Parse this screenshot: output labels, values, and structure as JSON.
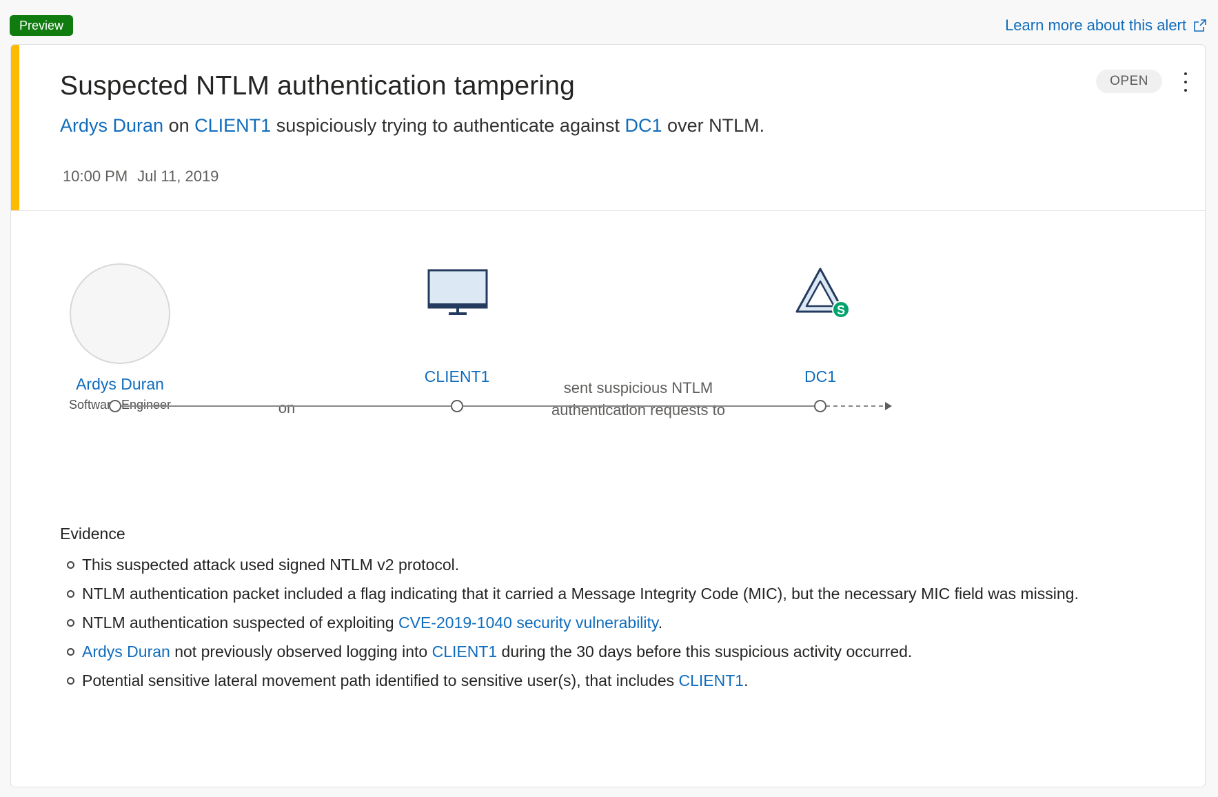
{
  "preview_badge": "Preview",
  "learn_more": {
    "label": "Learn more about this alert",
    "icon": "external-link-icon"
  },
  "alert": {
    "title": "Suspected NTLM authentication tampering",
    "description": {
      "user": "Ardys Duran",
      "text1": "on",
      "computer": "CLIENT1",
      "text2": "suspiciously trying to authenticate against",
      "target": "DC1",
      "text3": "over NTLM."
    },
    "time": "10:00 PM",
    "date": "Jul 11, 2019",
    "status": "OPEN",
    "accent_color": "#ffb900"
  },
  "diagram": {
    "user": {
      "name": "Ardys Duran",
      "role": "Software Engineer",
      "icon": "user-avatar"
    },
    "computer": {
      "name": "CLIENT1",
      "icon": "monitor-icon"
    },
    "dc": {
      "name": "DC1",
      "icon": "domain-controller-icon",
      "badge": "S"
    },
    "edge1_label": "on",
    "edge2_label_line1": "sent suspicious NTLM",
    "edge2_label_line2": "authentication requests to"
  },
  "evidence": {
    "title": "Evidence",
    "items": {
      "i1": {
        "text": "This suspected attack used signed NTLM v2 protocol."
      },
      "i2": {
        "text": "NTLM authentication packet included a flag indicating that it carried a Message Integrity Code (MIC), but the necessary MIC field was missing."
      },
      "i3": {
        "pre": "NTLM authentication suspected of exploiting ",
        "link": "CVE-2019-1040 security vulnerability",
        "post": "."
      },
      "i4": {
        "link1": "Ardys Duran",
        "mid": " not previously observed logging into ",
        "link2": "CLIENT1",
        "post": " during the 30 days before this suspicious activity occurred."
      },
      "i5": {
        "pre": "Potential sensitive lateral movement path identified to sensitive user(s), that includes ",
        "link": "CLIENT1",
        "post": "."
      }
    }
  }
}
